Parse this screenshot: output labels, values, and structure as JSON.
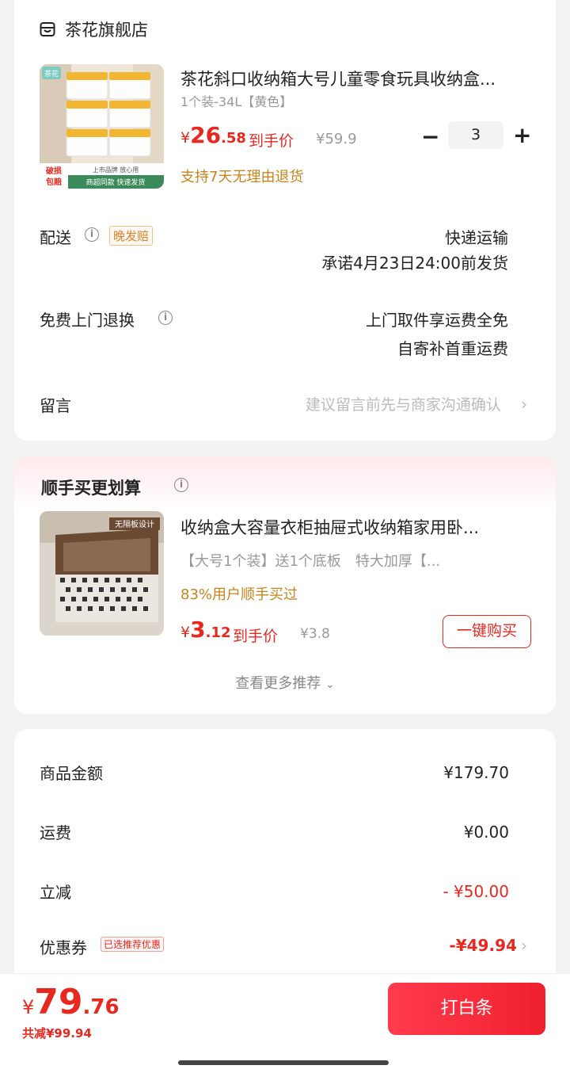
{
  "store": {
    "name": "茶花旗舰店",
    "product": {
      "title": "茶花斜口收纳箱大号儿童零食玩具收纳盒...",
      "spec": "1个装-34L【黄色】",
      "price_symbol": "¥",
      "price_int": "26",
      "price_dec": ".58",
      "price_tag": "到手价",
      "original_price": "¥59.9",
      "quantity": "3",
      "return_policy": "支持7天无理由退货",
      "image_badge_brand": "茶花",
      "image_badge_left": "破损包赔",
      "image_badge_top": "上市品牌 放心用",
      "image_badge_bottom": "商超同款 快速发货"
    },
    "delivery": {
      "label": "配送",
      "badge": "晚发赔",
      "method": "快递运输",
      "promise": "承诺4月23日24:00前发货"
    },
    "return": {
      "label": "免费上门退换",
      "line1": "上门取件享运费全免",
      "line2": "自寄补首重运费"
    },
    "message": {
      "label": "留言",
      "placeholder": "建议留言前先与商家沟通确认"
    }
  },
  "recommend": {
    "title": "顺手买更划算",
    "product": {
      "title": "收纳盒大容量衣柜抽屉式收纳箱家用卧...",
      "spec": "【大号1个装】送1个底板　特大加厚【...",
      "users": "83%用户顺手买过",
      "price_symbol": "¥",
      "price_int": "3",
      "price_dec": ".12",
      "price_tag": "到手价",
      "original_price": "¥3.8",
      "buy_label": "一键购买",
      "image_badge": "无隔板设计"
    },
    "more_label": "查看更多推荐"
  },
  "summary": {
    "rows": [
      {
        "label": "商品金额",
        "value": "¥179.70"
      },
      {
        "label": "运费",
        "value": "¥0.00"
      },
      {
        "label": "立减",
        "value": "- ¥50.00"
      },
      {
        "label": "优惠券",
        "value": "-¥49.94"
      }
    ],
    "coupon_tag": "已选推荐优惠"
  },
  "bottom": {
    "total_symbol": "¥",
    "total_int": "79",
    "total_dec": ".76",
    "saved": "共减¥99.94",
    "pay_label": "打白条"
  },
  "colors": {
    "accent": "#e8281e",
    "orange": "#c8841c"
  }
}
